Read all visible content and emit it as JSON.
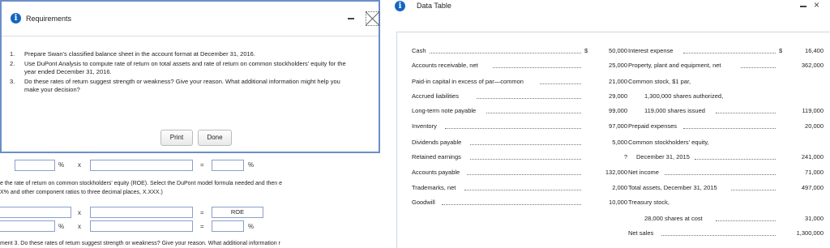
{
  "requirements": {
    "title": "Requirements",
    "items": [
      {
        "n": "1.",
        "text": "Prepare Swan's classified balance sheet in the account format at December 31, 2016."
      },
      {
        "n": "2.",
        "text": "Use DuPont Analysis to compute rate of return on total assets and rate of return on common stockholders' equity for the year ended December 31, 2016."
      },
      {
        "n": "3.",
        "text": "Do these rates of return suggest strength or weakness? Give your reason. What additional information might help you make your decision?"
      }
    ],
    "print_label": "Print",
    "done_label": "Done"
  },
  "background": {
    "row1_pct": "%",
    "row1_x": "x",
    "row1_eq": "=",
    "row1_pct2": "%",
    "instruction_line1": "e the rate of return on common stockholders' equity (ROE). Select the DuPont model formula needed and then e",
    "instruction_line2": "X% and other component ratios to three decimal places, X.XXX.)",
    "row2_x": "x",
    "row2_eq": "=",
    "row2_roe": "ROE",
    "row3_pct": "%",
    "row3_x": "x",
    "row3_eq": "=",
    "row3_pct2": "%",
    "footer": "ment 3. Do these rates of return suggest strength or weakness? Give your reason. What additional information r"
  },
  "data_table": {
    "title": "Data Table",
    "left": [
      {
        "label": "Cash",
        "cur": "$",
        "value": "50,000"
      },
      {
        "label": "Accounts receivable, net",
        "cur": "",
        "value": "25,000"
      },
      {
        "label": "Paid-in capital in excess of par—common",
        "cur": "",
        "value": "21,000"
      },
      {
        "label": "Accrued liabilities",
        "cur": "",
        "value": "29,000"
      },
      {
        "label": "Long-term note payable",
        "cur": "",
        "value": "99,000"
      },
      {
        "label": "Inventory",
        "cur": "",
        "value": "97,000"
      },
      {
        "label": "Dividends payable",
        "cur": "",
        "value": "5,000"
      },
      {
        "label": "Retained earnings",
        "cur": "",
        "value": "?"
      },
      {
        "label": "Accounts payable",
        "cur": "",
        "value": "132,000"
      },
      {
        "label": "Trademarks, net",
        "cur": "",
        "value": "2,000"
      },
      {
        "label": "Goodwill",
        "cur": "",
        "value": "10,000"
      }
    ],
    "right": [
      {
        "label": "Interest expense",
        "cur": "$",
        "value": "16,400"
      },
      {
        "label": "Property, plant and equipment, net",
        "cur": "",
        "value": "362,000"
      },
      {
        "label": "Common stock, $1 par,",
        "cur": "",
        "value": ""
      },
      {
        "label": "1,300,000 shares authorized,",
        "cur": "",
        "value": ""
      },
      {
        "label": "119,000 shares issued",
        "cur": "",
        "value": "119,000"
      },
      {
        "label": "Prepaid expenses",
        "cur": "",
        "value": "20,000"
      },
      {
        "label": "Common stockholders' equity,",
        "cur": "",
        "value": ""
      },
      {
        "label": "December 31, 2015",
        "cur": "",
        "value": "241,000"
      },
      {
        "label": "Net income",
        "cur": "",
        "value": "71,000"
      },
      {
        "label": "Total assets, December 31, 2015",
        "cur": "",
        "value": "497,000"
      },
      {
        "label": "Treasury stock,",
        "cur": "",
        "value": ""
      },
      {
        "label": "28,000 shares at cost",
        "cur": "",
        "value": "31,000"
      },
      {
        "label": "Net sales",
        "cur": "",
        "value": "1,300,000"
      }
    ]
  }
}
